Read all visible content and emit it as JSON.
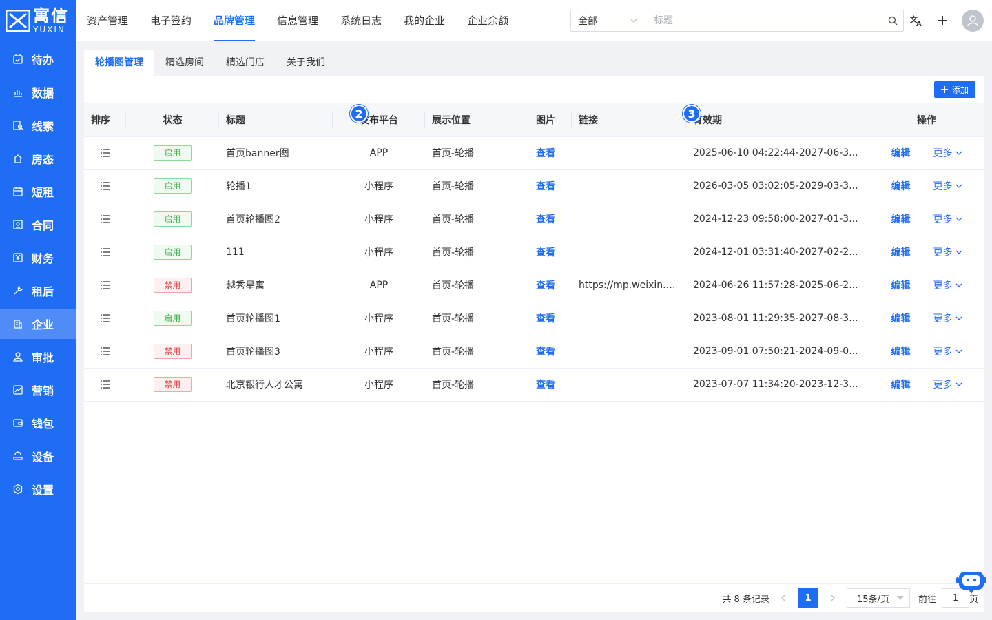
{
  "logo": {
    "cn": "寓信",
    "en": "YUXIN"
  },
  "sidebar": {
    "items": [
      {
        "label": "待办",
        "icon": "calendar-check-icon"
      },
      {
        "label": "数据",
        "icon": "bar-chart-icon"
      },
      {
        "label": "线索",
        "icon": "clue-search-icon"
      },
      {
        "label": "房态",
        "icon": "house-icon"
      },
      {
        "label": "短租",
        "icon": "calendar-icon"
      },
      {
        "label": "合同",
        "icon": "contract-icon"
      },
      {
        "label": "财务",
        "icon": "yen-icon"
      },
      {
        "label": "租后",
        "icon": "wrench-icon"
      },
      {
        "label": "企业",
        "icon": "building-icon"
      },
      {
        "label": "审批",
        "icon": "user-icon"
      },
      {
        "label": "营销",
        "icon": "trend-icon"
      },
      {
        "label": "钱包",
        "icon": "wallet-icon"
      },
      {
        "label": "设备",
        "icon": "device-icon"
      },
      {
        "label": "设置",
        "icon": "gear-icon"
      }
    ],
    "active_index": 8
  },
  "topnav": {
    "items": [
      "资产管理",
      "电子签约",
      "品牌管理",
      "信息管理",
      "系统日志",
      "我的企业",
      "企业余额"
    ],
    "active_index": 2
  },
  "search": {
    "scope": "全部",
    "placeholder": "标题"
  },
  "subtabs": {
    "items": [
      "轮播图管理",
      "精选房间",
      "精选门店",
      "关于我们"
    ],
    "active_index": 0
  },
  "toolbar": {
    "add_label": "添加"
  },
  "table": {
    "headers": [
      "排序",
      "状态",
      "标题",
      "发布平台",
      "展示位置",
      "图片",
      "链接",
      "有效期",
      "操作"
    ],
    "rows": [
      {
        "status": "启用",
        "enabled": true,
        "title": "首页banner图",
        "platform": "APP",
        "position": "首页-轮播",
        "image": "查看",
        "link": "",
        "validity": "2025-06-10 04:22:44-2027-06-3..."
      },
      {
        "status": "启用",
        "enabled": true,
        "title": "轮播1",
        "platform": "小程序",
        "position": "首页-轮播",
        "image": "查看",
        "link": "",
        "validity": "2026-03-05 03:02:05-2029-03-3..."
      },
      {
        "status": "启用",
        "enabled": true,
        "title": "首页轮播图2",
        "platform": "小程序",
        "position": "首页-轮播",
        "image": "查看",
        "link": "",
        "validity": "2024-12-23 09:58:00-2027-01-3..."
      },
      {
        "status": "启用",
        "enabled": true,
        "title": "111",
        "platform": "小程序",
        "position": "首页-轮播",
        "image": "查看",
        "link": "",
        "validity": "2024-12-01 03:31:40-2027-02-2..."
      },
      {
        "status": "禁用",
        "enabled": false,
        "title": "越秀星寓",
        "platform": "APP",
        "position": "首页-轮播",
        "image": "查看",
        "link": "https://mp.weixin.qq....",
        "validity": "2024-06-26 11:57:28-2025-06-2..."
      },
      {
        "status": "启用",
        "enabled": true,
        "title": "首页轮播图1",
        "platform": "小程序",
        "position": "首页-轮播",
        "image": "查看",
        "link": "",
        "validity": "2023-08-01 11:29:35-2027-08-3..."
      },
      {
        "status": "禁用",
        "enabled": false,
        "title": "首页轮播图3",
        "platform": "小程序",
        "position": "首页-轮播",
        "image": "查看",
        "link": "",
        "validity": "2023-09-01 07:50:21-2024-09-0..."
      },
      {
        "status": "禁用",
        "enabled": false,
        "title": "北京银行人才公寓",
        "platform": "小程序",
        "position": "首页-轮播",
        "image": "查看",
        "link": "",
        "validity": "2023-07-07 11:34:20-2023-12-3..."
      }
    ],
    "edit_label": "编辑",
    "more_label": "更多"
  },
  "markers": [
    "2",
    "3"
  ],
  "pagination": {
    "total": "共 8 条记录",
    "current": "1",
    "page_size": "15条/页",
    "goto": "前往",
    "goto_value": "1",
    "page_suffix": "页"
  },
  "colors": {
    "primary": "#1f6df5",
    "enabled": "#3bb24a",
    "disabled": "#e24a4a"
  }
}
